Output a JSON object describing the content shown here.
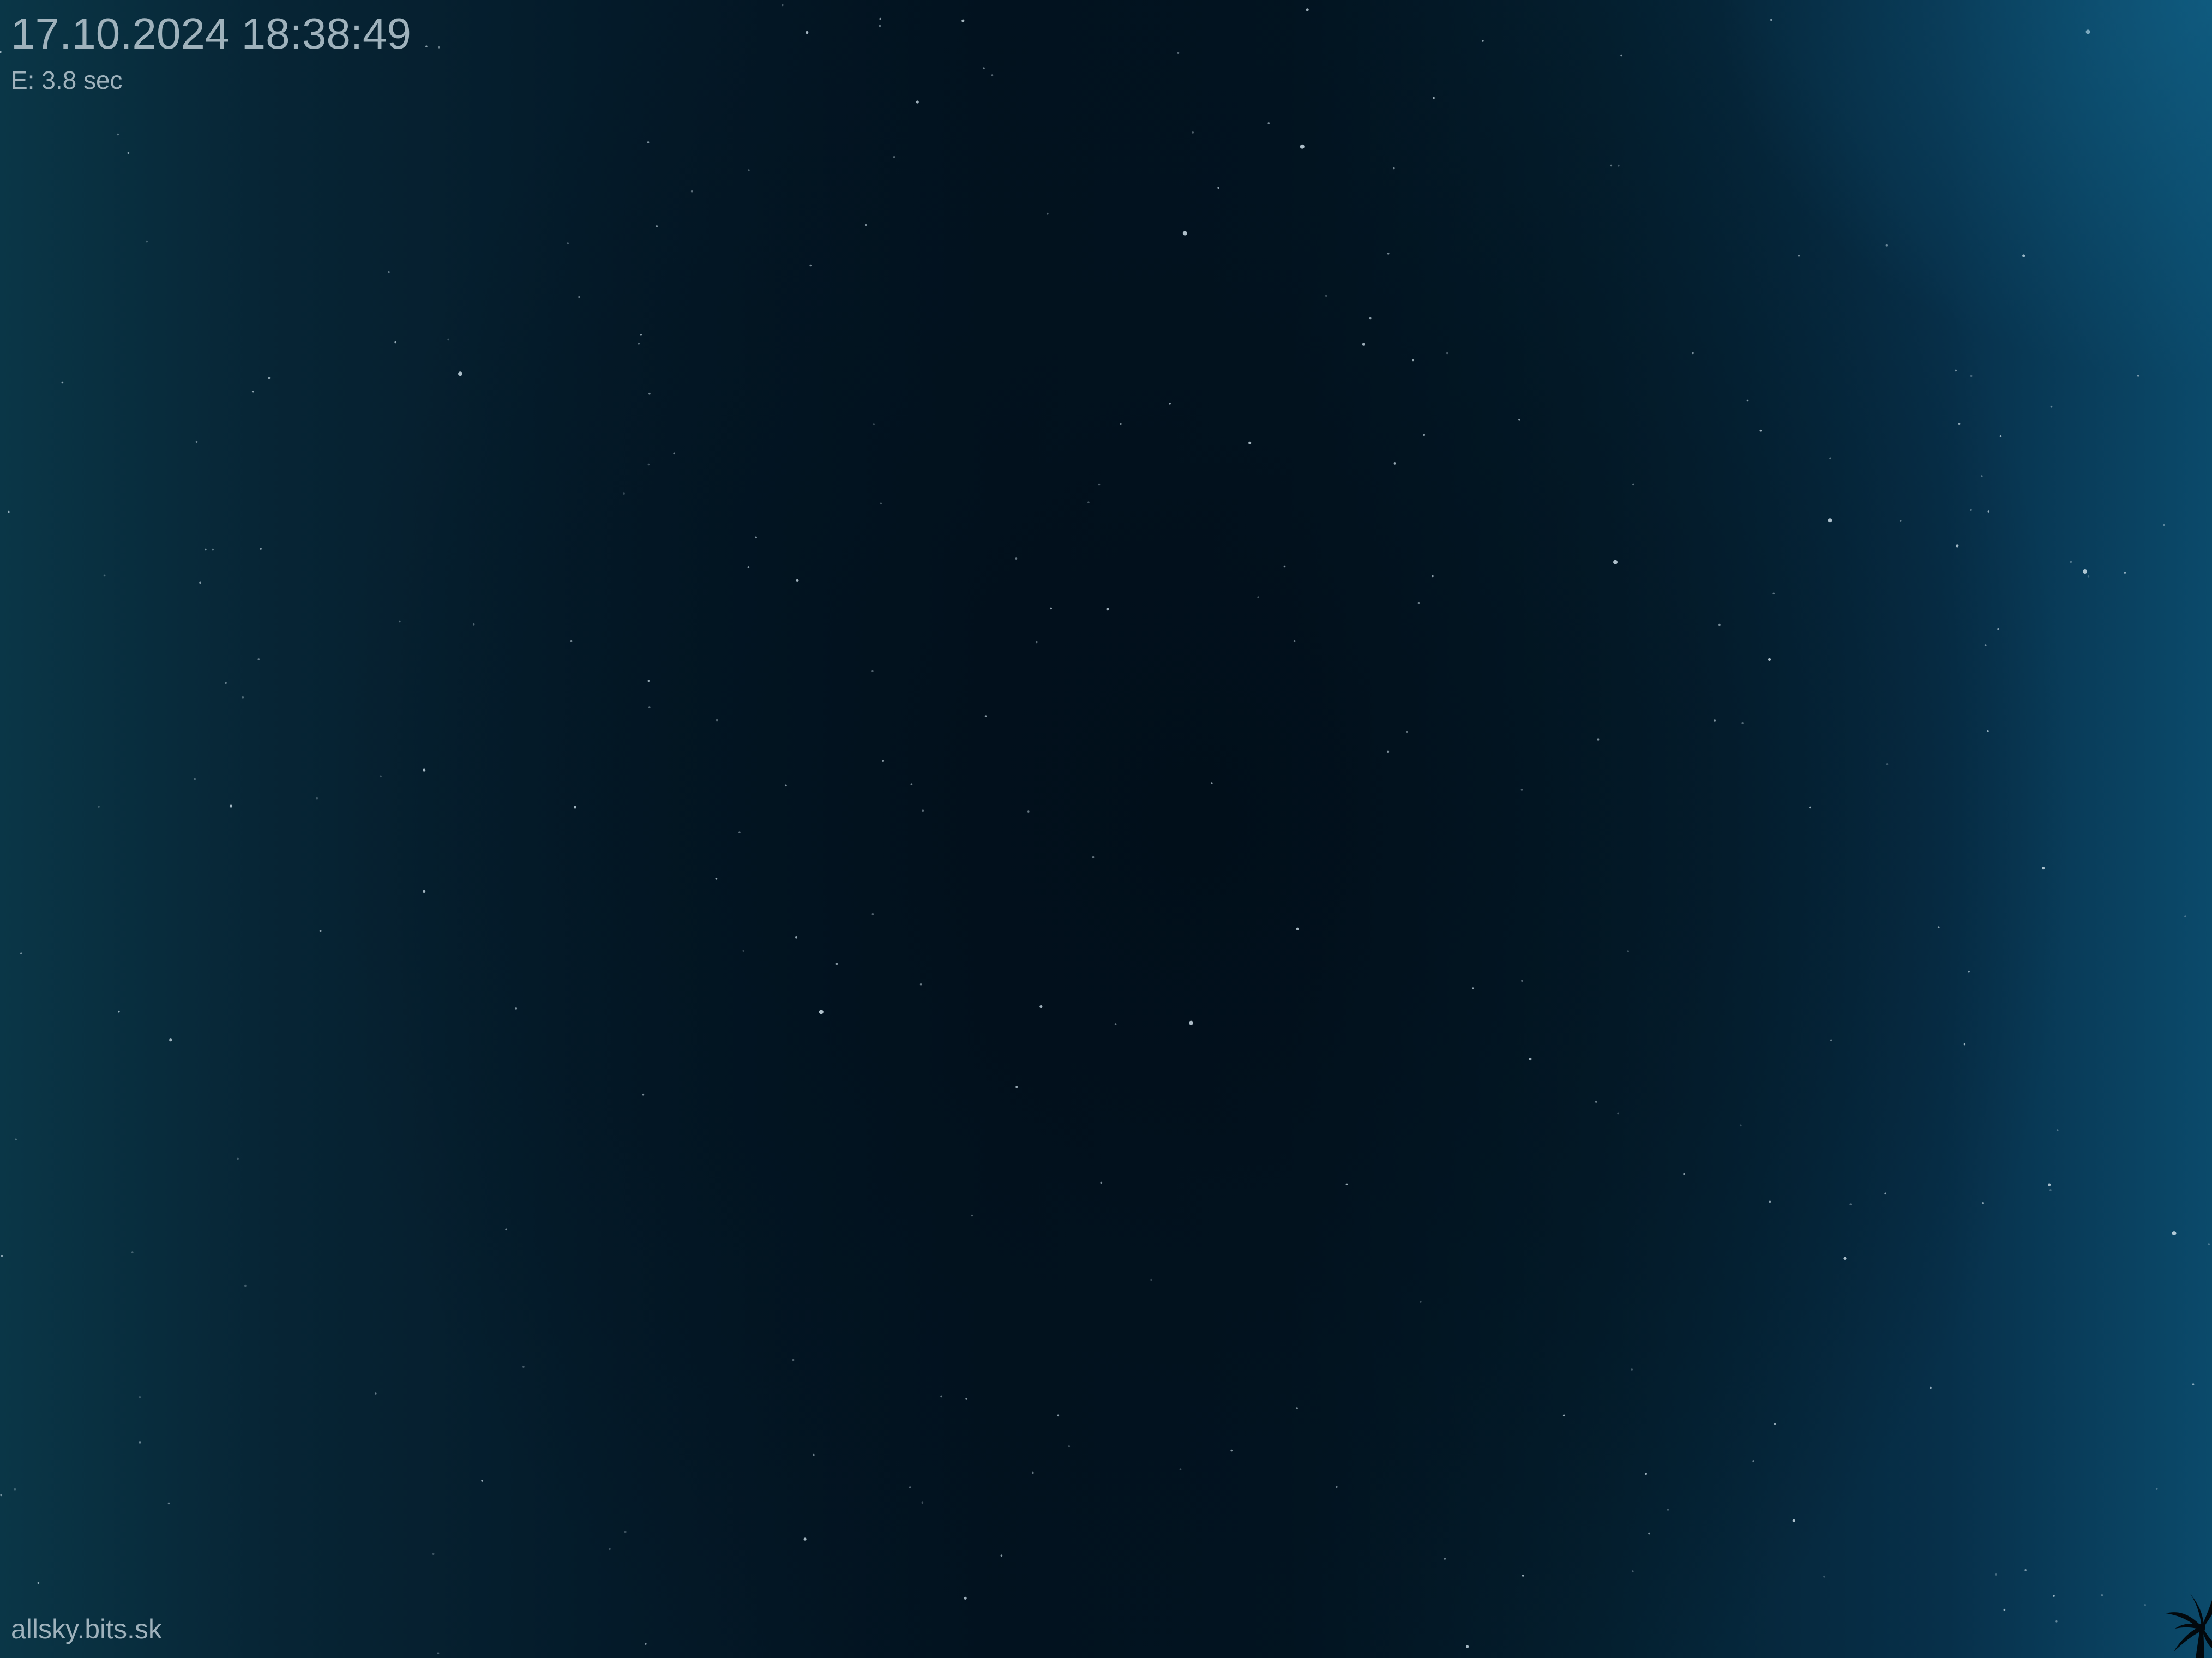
{
  "overlay": {
    "timestamp": "17.10.2024 18:38:49",
    "exposure": "E: 3.8 sec",
    "site": "allsky.bits.sk"
  },
  "colors": {
    "sky_center": "#02121f",
    "sky_edge_left": "#0a3647",
    "sky_edge_right": "#0b4a6b",
    "overlay_text": "#9fb2bc",
    "star": "#cfe0ea",
    "silhouette": "#02080c"
  },
  "icons": {
    "corner_silhouette": "palm-tree-silhouette-icon"
  }
}
